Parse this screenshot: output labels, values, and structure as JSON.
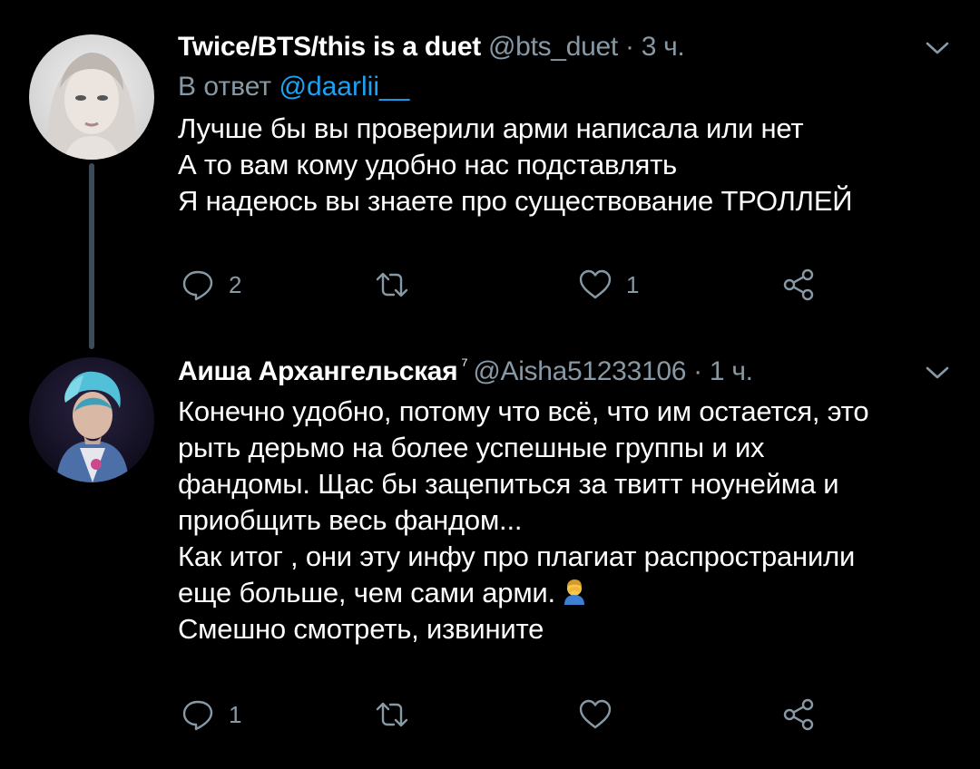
{
  "tweets": [
    {
      "display_name": "Twice/BTS/this is a duet",
      "handle": "@bts_duet",
      "separator": "·",
      "time": "3 ч.",
      "reply_prefix": "В ответ",
      "reply_mention": "@daarlii__",
      "lines": [
        "Лучше бы вы проверили арми написала или нет",
        "А то вам кому удобно нас подставлять",
        "Я надеюсь вы знаете про существование ТРОЛЛЕЙ"
      ],
      "reply_count": "2",
      "retweet_count": "",
      "like_count": "1"
    },
    {
      "display_name": "Аиша Архангельская",
      "verified_mark": "⁷",
      "handle": "@Aisha51233106",
      "separator": "·",
      "time": "1 ч.",
      "lines": [
        "Конечно удобно, потому что всё, что им остается, это",
        "рыть дерьмо на более успешные группы и их",
        "фандомы. Щас бы зацепиться за твитт ноунейма и",
        "приобщить весь фандом...",
        "Как итог , они эту инфу про плагиат распространили",
        "еще больше, чем сами арми.",
        "Смешно смотреть, извините"
      ],
      "emoji": "facepalm-emoji",
      "reply_count": "1",
      "retweet_count": "",
      "like_count": ""
    }
  ],
  "icons": {
    "caret": "chevron-down-icon",
    "reply": "reply-icon",
    "retweet": "retweet-icon",
    "like": "heart-icon",
    "share": "share-icon"
  },
  "colors": {
    "background": "#000000",
    "text": "#ffffff",
    "muted": "#8899a6",
    "link": "#1da1f2",
    "thread_line": "#3d4a57"
  }
}
